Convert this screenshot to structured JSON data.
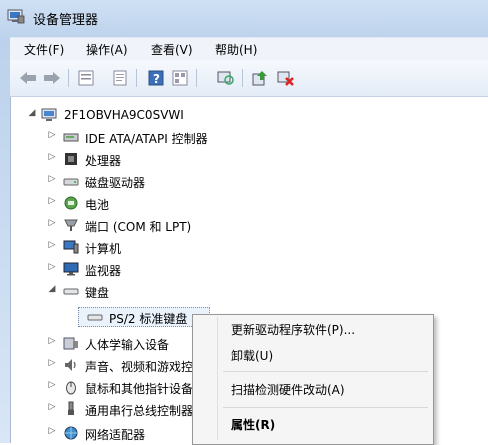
{
  "window": {
    "title": "设备管理器",
    "icon": "device-manager-icon"
  },
  "menubar": {
    "items": [
      "文件(F)",
      "操作(A)",
      "查看(V)",
      "帮助(H)"
    ]
  },
  "toolbar": {
    "buttons": [
      "back-icon",
      "forward-icon",
      "properties-grid-icon",
      "properties-icon",
      "help-icon",
      "view-icon",
      "scan-hardware-icon",
      "update-driver-icon",
      "uninstall-icon"
    ]
  },
  "tree": {
    "root": "2F1OBVHA9C0SVWI",
    "nodes": [
      {
        "label": "IDE ATA/ATAPI 控制器",
        "icon": "ide-controller-icon",
        "expanded": false
      },
      {
        "label": "处理器",
        "icon": "processor-icon",
        "expanded": false
      },
      {
        "label": "磁盘驱动器",
        "icon": "disk-drive-icon",
        "expanded": false
      },
      {
        "label": "电池",
        "icon": "battery-icon",
        "expanded": false
      },
      {
        "label": "端口 (COM 和 LPT)",
        "icon": "port-icon",
        "expanded": false
      },
      {
        "label": "计算机",
        "icon": "computer-icon",
        "expanded": false
      },
      {
        "label": "监视器",
        "icon": "monitor-icon",
        "expanded": false
      },
      {
        "label": "键盘",
        "icon": "keyboard-icon",
        "expanded": true
      },
      {
        "label": "PS/2 标准键盘",
        "icon": "keyboard-icon",
        "child": true
      },
      {
        "label": "人体学输入设备",
        "icon": "hid-icon",
        "expanded": false
      },
      {
        "label": "声音、视频和游戏控制器",
        "icon": "sound-icon",
        "expanded": false
      },
      {
        "label": "鼠标和其他指针设备",
        "icon": "mouse-icon",
        "expanded": false
      },
      {
        "label": "通用串行总线控制器",
        "icon": "usb-icon",
        "expanded": false
      },
      {
        "label": "网络适配器",
        "icon": "network-adapter-icon",
        "expanded": false
      }
    ]
  },
  "context_menu": {
    "items": [
      {
        "label": "更新驱动程序软件(P)..."
      },
      {
        "label": "卸载(U)"
      },
      {
        "label": "扫描检测硬件改动(A)"
      },
      {
        "label": "属性(R)",
        "bold": true
      }
    ]
  }
}
